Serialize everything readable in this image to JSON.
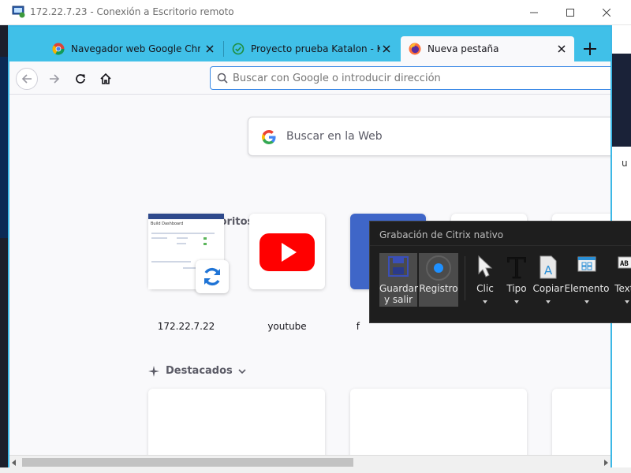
{
  "rdp": {
    "title": "172.22.7.23 - Conexión a Escritorio remoto",
    "controls": [
      "minimize",
      "maximize",
      "close"
    ]
  },
  "browser": {
    "tabs": [
      {
        "title": "Navegador web Google Chrome",
        "icon": "chrome-icon",
        "active": false
      },
      {
        "title": "Proyecto prueba Katalon - Katalon",
        "icon": "katalon-check-icon",
        "active": false
      },
      {
        "title": "Nueva pestaña",
        "icon": "firefox-icon",
        "active": true
      }
    ],
    "new_tab_icon": "plus-icon",
    "nav": {
      "back_icon": "back-arrow-icon",
      "forward_icon": "forward-arrow-icon",
      "reload_icon": "reload-icon",
      "home_icon": "home-icon"
    },
    "urlbar": {
      "placeholder": "Buscar con Google o introducir dirección",
      "value": ""
    },
    "accent_color": "#40c0e8"
  },
  "newtab": {
    "search_placeholder": "Buscar en la Web",
    "top_sites_heading": "Sitios favoritos",
    "top_sites": [
      {
        "label": "172.22.7.22"
      },
      {
        "label": "youtube"
      },
      {
        "label": "f"
      }
    ],
    "highlights_heading": "Destacados",
    "dashboard_thumb": {
      "brand": "Bamboo",
      "heading": "Build Dashboard"
    }
  },
  "citrix": {
    "title": "Grabación de Citrix nativo",
    "buttons": [
      {
        "label_line1": "Guardar",
        "label_line2": "y salir",
        "icon": "save-exit-icon",
        "pressed": true
      },
      {
        "label_line1": "Registro",
        "label_line2": "",
        "icon": "record-icon",
        "pressed": true
      },
      {
        "label_line1": "Clic",
        "label_line2": "",
        "icon": "cursor-icon",
        "pressed": false
      },
      {
        "label_line1": "Tipo",
        "label_line2": "",
        "icon": "type-icon",
        "pressed": false
      },
      {
        "label_line1": "Copiar",
        "label_line2": "",
        "icon": "copy-text-icon",
        "pressed": false
      },
      {
        "label_line1": "Elemento",
        "label_line2": "",
        "icon": "element-icon",
        "pressed": false
      },
      {
        "label_line1": "Texto",
        "label_line2": "",
        "icon": "text-icon",
        "pressed": false
      }
    ]
  }
}
